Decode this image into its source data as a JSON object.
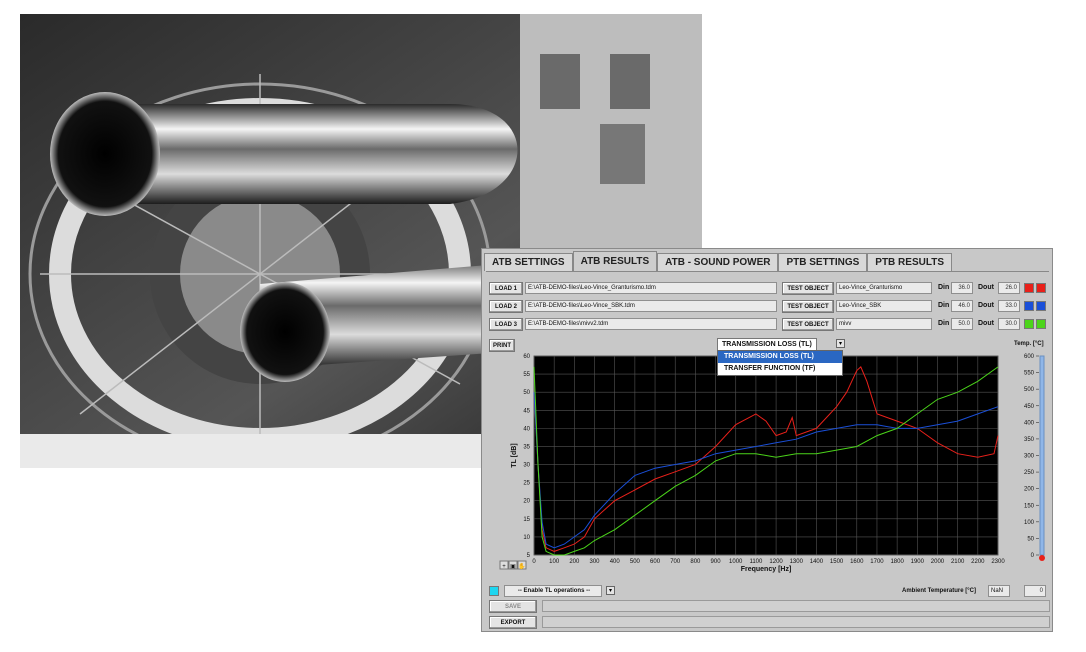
{
  "tabs": [
    {
      "label": "ATB SETTINGS",
      "active": false
    },
    {
      "label": "ATB RESULTS",
      "active": true
    },
    {
      "label": "ATB - SOUND POWER",
      "active": false
    },
    {
      "label": "PTB SETTINGS",
      "active": false
    },
    {
      "label": "PTB RESULTS",
      "active": false
    }
  ],
  "loads": [
    {
      "button": "LOAD 1",
      "path": "E:\\ATB-DEMO-files\\Leo-Vince_Granturismo.tdm",
      "test_label": "TEST OBJECT",
      "test_object": "Leo-Vince_Granturismo",
      "din_label": "Din",
      "din": "36.0",
      "dout_label": "Dout",
      "dout": "26.0",
      "color": "#e8201a"
    },
    {
      "button": "LOAD 2",
      "path": "E:\\ATB-DEMO-files\\Leo-Vince_SBK.tdm",
      "test_label": "TEST OBJECT",
      "test_object": "Leo-Vince_SBK",
      "din_label": "Din",
      "din": "46.0",
      "dout_label": "Dout",
      "dout": "33.0",
      "color": "#1a4fd8"
    },
    {
      "button": "LOAD 3",
      "path": "E:\\ATB-DEMO-files\\mivv2.tdm",
      "test_label": "TEST OBJECT",
      "test_object": "mivv",
      "din_label": "Din",
      "din": "50.0",
      "dout_label": "Dout",
      "dout": "30.0",
      "color": "#4bd41a"
    }
  ],
  "print_label": "PRINT",
  "mode_select": {
    "selected": "TRANSMISSION LOSS (TL)",
    "options": [
      "TRANSMISSION LOSS (TL)",
      "TRANSFER FUNCTION (TF)"
    ]
  },
  "temp_scale": {
    "label": "Temp. [°C]",
    "ticks": [
      "600",
      "550",
      "500",
      "450",
      "400",
      "350",
      "300",
      "250",
      "200",
      "150",
      "100",
      "50",
      "0"
    ],
    "value": 0,
    "max": 600
  },
  "tl_select": "-- Enable TL operations --",
  "ambient": {
    "label": "Ambient Temperature [°C]",
    "nan": "NaN",
    "value": "0"
  },
  "save_label": "SAVE",
  "export_label": "EXPORT",
  "chart_data": {
    "type": "line",
    "xlabel": "Frequency [Hz]",
    "ylabel": "TL [dB]",
    "xlim": [
      0,
      2300
    ],
    "ylim": [
      5,
      60
    ],
    "x_ticks": [
      0,
      100,
      200,
      300,
      400,
      500,
      600,
      700,
      800,
      900,
      1000,
      1100,
      1200,
      1300,
      1400,
      1500,
      1600,
      1700,
      1800,
      1900,
      2000,
      2100,
      2200,
      2300
    ],
    "y_ticks": [
      5,
      10,
      15,
      20,
      25,
      30,
      35,
      40,
      45,
      50,
      55,
      60
    ],
    "grid": true,
    "series": [
      {
        "color": "#e8201a",
        "points": [
          [
            0,
            50
          ],
          [
            20,
            30
          ],
          [
            40,
            12
          ],
          [
            60,
            7
          ],
          [
            100,
            6
          ],
          [
            150,
            7
          ],
          [
            200,
            8
          ],
          [
            250,
            10
          ],
          [
            300,
            15
          ],
          [
            400,
            20
          ],
          [
            500,
            23
          ],
          [
            600,
            26
          ],
          [
            700,
            28
          ],
          [
            800,
            30
          ],
          [
            900,
            35
          ],
          [
            1000,
            41
          ],
          [
            1100,
            44
          ],
          [
            1150,
            42
          ],
          [
            1200,
            38
          ],
          [
            1250,
            39
          ],
          [
            1280,
            43
          ],
          [
            1300,
            38
          ],
          [
            1400,
            40
          ],
          [
            1500,
            46
          ],
          [
            1550,
            50
          ],
          [
            1600,
            56
          ],
          [
            1620,
            57
          ],
          [
            1650,
            53
          ],
          [
            1700,
            44
          ],
          [
            1800,
            42
          ],
          [
            1900,
            40
          ],
          [
            2000,
            36
          ],
          [
            2100,
            33
          ],
          [
            2200,
            32
          ],
          [
            2280,
            33
          ],
          [
            2300,
            38
          ]
        ]
      },
      {
        "color": "#1a4fd8",
        "points": [
          [
            0,
            50
          ],
          [
            20,
            30
          ],
          [
            40,
            14
          ],
          [
            60,
            8
          ],
          [
            100,
            7
          ],
          [
            150,
            8
          ],
          [
            200,
            10
          ],
          [
            250,
            12
          ],
          [
            300,
            16
          ],
          [
            400,
            22
          ],
          [
            500,
            27
          ],
          [
            600,
            29
          ],
          [
            700,
            30
          ],
          [
            800,
            31
          ],
          [
            900,
            33
          ],
          [
            1000,
            34
          ],
          [
            1100,
            35
          ],
          [
            1200,
            36
          ],
          [
            1300,
            37
          ],
          [
            1400,
            39
          ],
          [
            1500,
            40
          ],
          [
            1600,
            41
          ],
          [
            1700,
            41
          ],
          [
            1800,
            40
          ],
          [
            1900,
            40
          ],
          [
            2000,
            41
          ],
          [
            2100,
            42
          ],
          [
            2200,
            44
          ],
          [
            2300,
            46
          ]
        ]
      },
      {
        "color": "#4bd41a",
        "points": [
          [
            0,
            57
          ],
          [
            20,
            30
          ],
          [
            40,
            10
          ],
          [
            60,
            6
          ],
          [
            100,
            5
          ],
          [
            150,
            5
          ],
          [
            200,
            6
          ],
          [
            250,
            7
          ],
          [
            300,
            9
          ],
          [
            400,
            12
          ],
          [
            500,
            16
          ],
          [
            600,
            20
          ],
          [
            700,
            24
          ],
          [
            800,
            27
          ],
          [
            900,
            31
          ],
          [
            1000,
            33
          ],
          [
            1100,
            33
          ],
          [
            1200,
            32
          ],
          [
            1300,
            33
          ],
          [
            1400,
            33
          ],
          [
            1500,
            34
          ],
          [
            1600,
            35
          ],
          [
            1700,
            38
          ],
          [
            1800,
            40
          ],
          [
            1900,
            44
          ],
          [
            2000,
            48
          ],
          [
            2100,
            50
          ],
          [
            2200,
            53
          ],
          [
            2300,
            57
          ]
        ]
      }
    ]
  }
}
